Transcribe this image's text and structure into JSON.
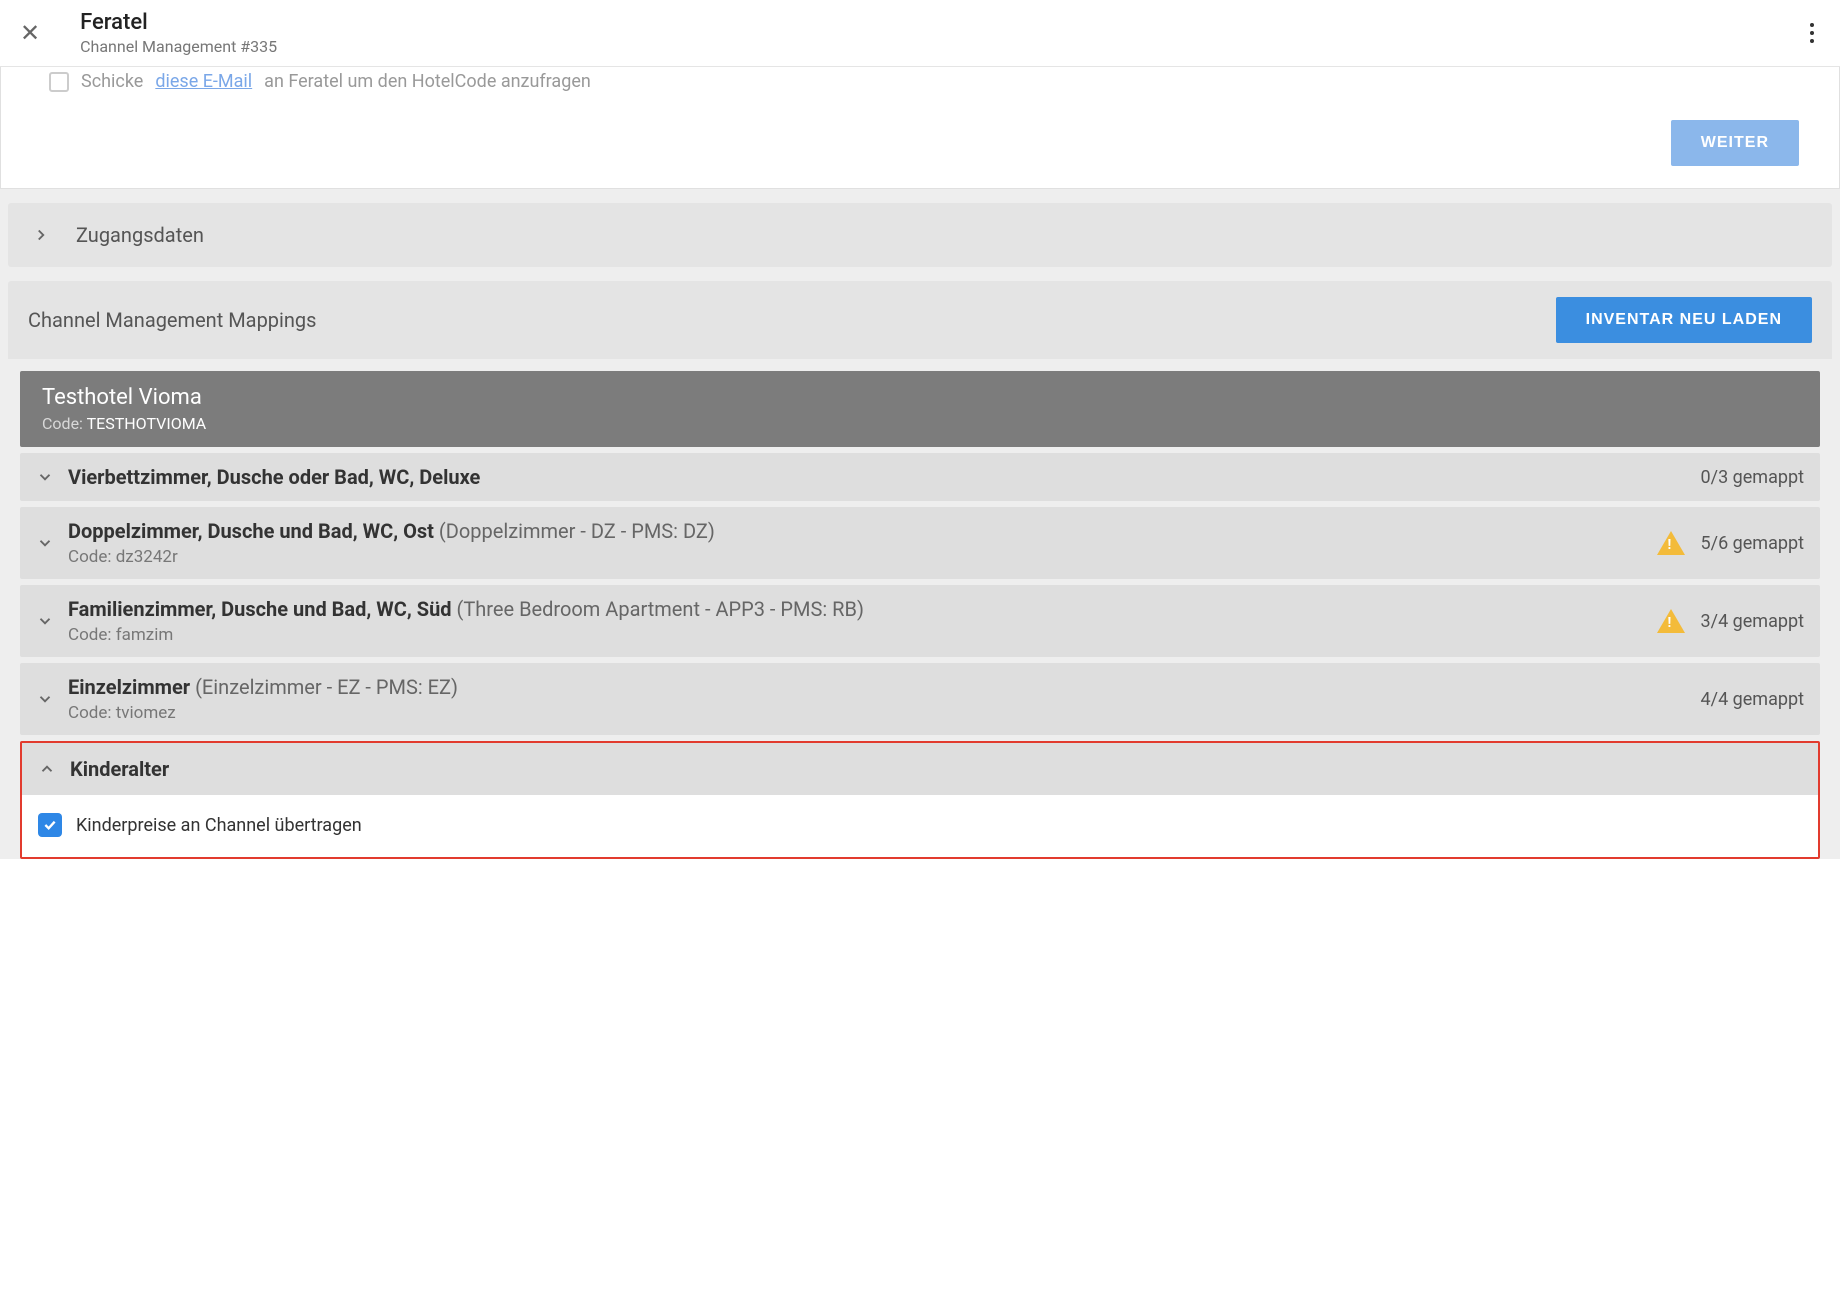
{
  "header": {
    "title": "Feratel",
    "subtitle": "Channel Management #335"
  },
  "panel": {
    "email_prefix": "Schicke",
    "email_link": "diese E-Mail",
    "email_suffix": "an Feratel um den HotelCode anzufragen",
    "continue_label": "WEITER"
  },
  "sections": {
    "zugangsdaten": "Zugangsdaten",
    "mappings_title": "Channel Management Mappings",
    "reload_label": "INVENTAR NEU LADEN"
  },
  "hotel": {
    "name": "Testhotel Vioma",
    "code_label": "Code:",
    "code": "TESTHOTVIOMA"
  },
  "rooms": [
    {
      "title_bold": "Vierbettzimmer, Dusche oder Bad, WC, Deluxe",
      "title_gray": "",
      "code_label": "",
      "code": "",
      "mapped": "0/3 gemappt",
      "warn": false
    },
    {
      "title_bold": "Doppelzimmer, Dusche und Bad, WC, Ost",
      "title_gray": " (Doppelzimmer - DZ - PMS: DZ)",
      "code_label": "Code:",
      "code": "dz3242r",
      "mapped": "5/6 gemappt",
      "warn": true
    },
    {
      "title_bold": "Familienzimmer, Dusche und Bad, WC, Süd",
      "title_gray": " (Three Bedroom Apartment - APP3 - PMS: RB)",
      "code_label": "Code:",
      "code": "famzim",
      "mapped": "3/4 gemappt",
      "warn": true
    },
    {
      "title_bold": "Einzelzimmer",
      "title_gray": " (Einzelzimmer - EZ - PMS: EZ)",
      "code_label": "Code:",
      "code": "tviomez",
      "mapped": "4/4 gemappt",
      "warn": false
    }
  ],
  "kinder": {
    "title": "Kinderalter",
    "checkbox_label": "Kinderpreise an Channel übertragen"
  }
}
